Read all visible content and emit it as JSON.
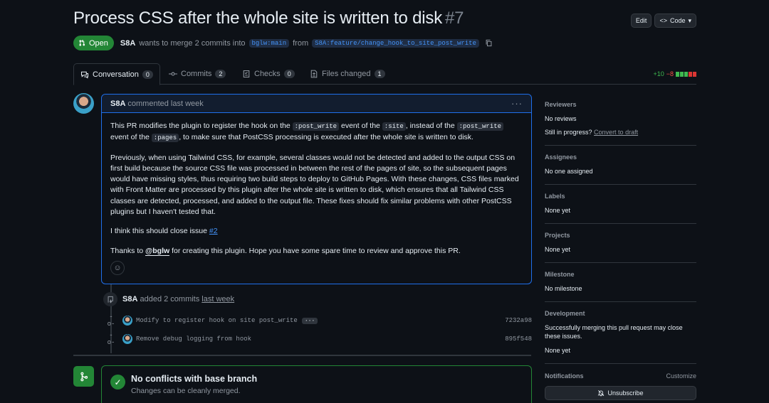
{
  "header": {
    "title": "Process CSS after the whole site is written to disk",
    "number": "#7",
    "edit_label": "Edit",
    "code_label": "Code",
    "state": "Open",
    "author": "S8A",
    "merge_text": "wants to merge 2 commits into",
    "base_branch": "bglw:main",
    "from_text": "from",
    "head_branch": "S8A:feature/change_hook_to_site_post_write"
  },
  "tabs": [
    {
      "label": "Conversation",
      "count": "0"
    },
    {
      "label": "Commits",
      "count": "2"
    },
    {
      "label": "Checks",
      "count": "0"
    },
    {
      "label": "Files changed",
      "count": "1"
    }
  ],
  "diffstat": {
    "additions": "+10",
    "deletions": "−8"
  },
  "colors": {
    "accent": "#1f6feb",
    "success": "#238636",
    "danger": "#da3633",
    "add": "#3fb950"
  },
  "comment": {
    "author": "S8A",
    "meta": "commented last week",
    "p1_a": "This PR modifies the plugin to register the hook on the",
    "p1_code1": ":post_write",
    "p1_b": "event of the",
    "p1_code2": ":site",
    "p1_c": ", instead of the",
    "p1_code3": ":post_write",
    "p1_d": "event of the",
    "p1_code4": ":pages",
    "p1_e": ", to make sure that PostCSS processing is executed after the whole site is written to disk.",
    "p2": "Previously, when using Tailwind CSS, for example, several classes would not be detected and added to the output CSS on first build because the source CSS file was processed in between the rest of the pages of site, so the subsequent pages would have missing styles, thus requiring two build steps to deploy to GitHub Pages. With these changes, CSS files marked with Front Matter are processed by this plugin after the whole site is written to disk, which ensures that all Tailwind CSS classes are detected, processed, and added to the output file. These fixes should fix similar problems with other PostCSS plugins but I haven't tested that.",
    "p3_a": "I think this should close issue",
    "p3_link": "#2",
    "p4_a": "Thanks to",
    "p4_mention": "@bglw",
    "p4_b": "for creating this plugin. Hope you have some spare time to review and approve this PR."
  },
  "event": {
    "author": "S8A",
    "text": "added 2 commits",
    "time": "last week"
  },
  "commits": [
    {
      "message": "Modify to register hook on site post_write",
      "sha": "7232a98",
      "has_more": true
    },
    {
      "message": "Remove debug logging from hook",
      "sha": "895f548",
      "has_more": false
    }
  ],
  "merge": {
    "title": "No conflicts with base branch",
    "subtitle": "Changes can be cleanly merged."
  },
  "sidebar": {
    "reviewers": {
      "heading": "Reviewers",
      "value": "No reviews",
      "progress_text": "Still in progress?",
      "progress_link": "Convert to draft"
    },
    "assignees": {
      "heading": "Assignees",
      "value": "No one assigned"
    },
    "labels": {
      "heading": "Labels",
      "value": "None yet"
    },
    "projects": {
      "heading": "Projects",
      "value": "None yet"
    },
    "milestone": {
      "heading": "Milestone",
      "value": "No milestone"
    },
    "development": {
      "heading": "Development",
      "text": "Successfully merging this pull request may close these issues.",
      "value": "None yet"
    },
    "notifications": {
      "heading": "Notifications",
      "customize": "Customize",
      "unsubscribe": "Unsubscribe"
    }
  }
}
